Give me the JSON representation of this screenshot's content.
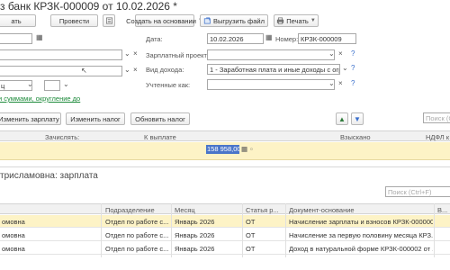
{
  "window": {
    "title": "з банк КРЗК-000009 от 10.02.2026 *"
  },
  "toolbar": {
    "cut_left_label": "ать",
    "post_label": "Провести",
    "create_based_label": "Создать на основании",
    "export_label": "Выгрузить файл",
    "print_label": "Печать"
  },
  "form": {
    "date_label": "Дата:",
    "date_value": "10.02.2026",
    "number_label": "Номер:",
    "number_value": "КРЗК-000009",
    "salary_project_label": "Зарплатный проект:",
    "income_type_label": "Вид дохода:",
    "income_type_value": "1 - Заработная плата и иные доходы с огра",
    "counted_as_label": "Учтенные как:",
    "left_field3_value": "ц",
    "rounding_link": "и суммами, округление до"
  },
  "list_toolbar": {
    "change_salary_label": "Изменить зарплату",
    "change_tax_label": "Изменить налог",
    "update_tax_label": "Обновить налог",
    "search_placeholder": "Поиск (Ctrl"
  },
  "main_table": {
    "headers": [
      "Зачислять:",
      "К выплате",
      "Взыскано",
      "НДФЛ к"
    ],
    "row": {
      "to_pay": "158 958,00"
    }
  },
  "details": {
    "title": "трисламовна: зарплата",
    "search_placeholder": "Поиск (Ctrl+F)",
    "headers": [
      "Подразделение",
      "Месяц",
      "Статья р...",
      "Документ-основание",
      "В..."
    ],
    "rows": [
      {
        "name": "омовна",
        "dept": "Отдел по работе с...",
        "month": "Январь 2026",
        "article": "ОТ",
        "doc": "Начисление зарплаты и взносов КРЗК-000000..."
      },
      {
        "name": "омовна",
        "dept": "Отдел по работе с...",
        "month": "Январь 2026",
        "article": "ОТ",
        "doc": "Начисление за первую половину месяца КРЗ..."
      },
      {
        "name": "омовна",
        "dept": "Отдел по работе с...",
        "month": "Январь 2026",
        "article": "ОТ",
        "doc": "Доход в натуральной форме КРЗК-000002 от ..."
      }
    ]
  },
  "colors": {
    "highlight_row": "#fdf3c6",
    "selected_value": "#4a75c9",
    "link": "#1c8a3a",
    "accent_blue": "#3a6fcc"
  },
  "icons": [
    "document-icon",
    "export-icon",
    "printer-icon",
    "calendar-icon",
    "arrow-up-icon",
    "arrow-down-icon",
    "calculator-icon"
  ]
}
